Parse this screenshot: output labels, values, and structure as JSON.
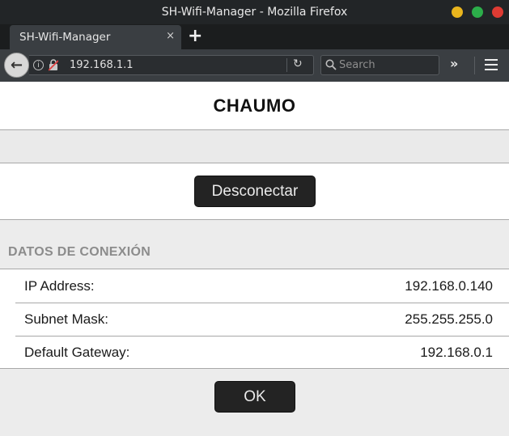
{
  "window": {
    "title": "SH-Wifi-Manager - Mozilla Firefox"
  },
  "tabs": [
    {
      "label": "SH-Wifi-Manager",
      "close": "×"
    }
  ],
  "toolbar": {
    "new_tab": "+",
    "back": "←",
    "url": "192.168.1.1",
    "reload": "↻",
    "search_placeholder": "Search",
    "overflow": "»"
  },
  "page": {
    "title": "CHAUMO",
    "disconnect_label": "Desconectar",
    "section_title": "DATOS DE CONEXIÓN",
    "connection": [
      {
        "label": "IP Address:",
        "value": "192.168.0.140"
      },
      {
        "label": "Subnet Mask:",
        "value": "255.255.255.0"
      },
      {
        "label": "Default Gateway:",
        "value": "192.168.0.1"
      }
    ],
    "ok_label": "OK"
  },
  "colors": {
    "window_controls": {
      "minimize": "#e9b51d",
      "maximize": "#2cae4a",
      "close": "#de3b33"
    },
    "button_bg": "#232323"
  },
  "icons": [
    "back-icon",
    "info-icon",
    "insecure-connection-icon",
    "reload-icon",
    "search-icon",
    "overflow-icon",
    "hamburger-menu-icon",
    "close-icon",
    "plus-icon"
  ]
}
